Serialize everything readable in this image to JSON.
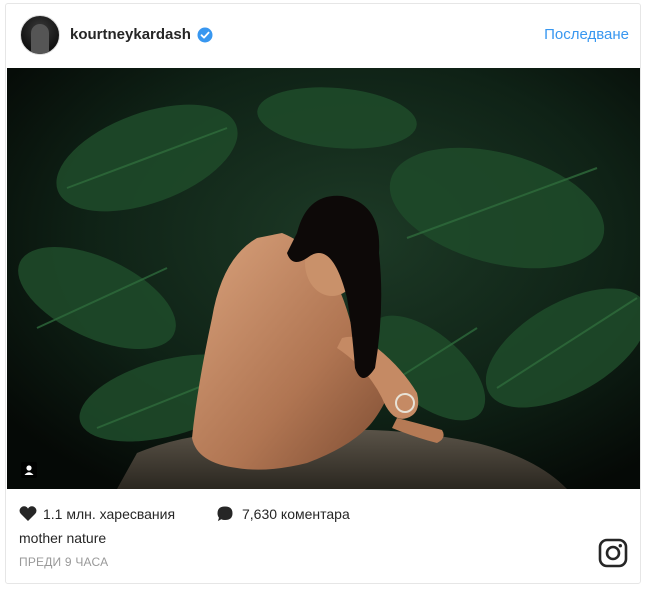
{
  "post": {
    "username": "kourtneykardash",
    "follow_label": "Последване",
    "likes_text": "1.1 млн. харесвания",
    "comments_text": "7,630 коментара",
    "caption": "mother nature",
    "timestamp": "ПРЕДИ 9 ЧАСА"
  },
  "icons": {
    "verified": "verified-badge-icon",
    "heart": "heart-icon",
    "comment": "comment-bubble-icon",
    "user_tag": "user-tag-icon",
    "logo": "instagram-logo-icon"
  },
  "colors": {
    "link": "#3897f0",
    "text": "#262626",
    "muted": "#999999",
    "border": "#e6e6e6"
  }
}
